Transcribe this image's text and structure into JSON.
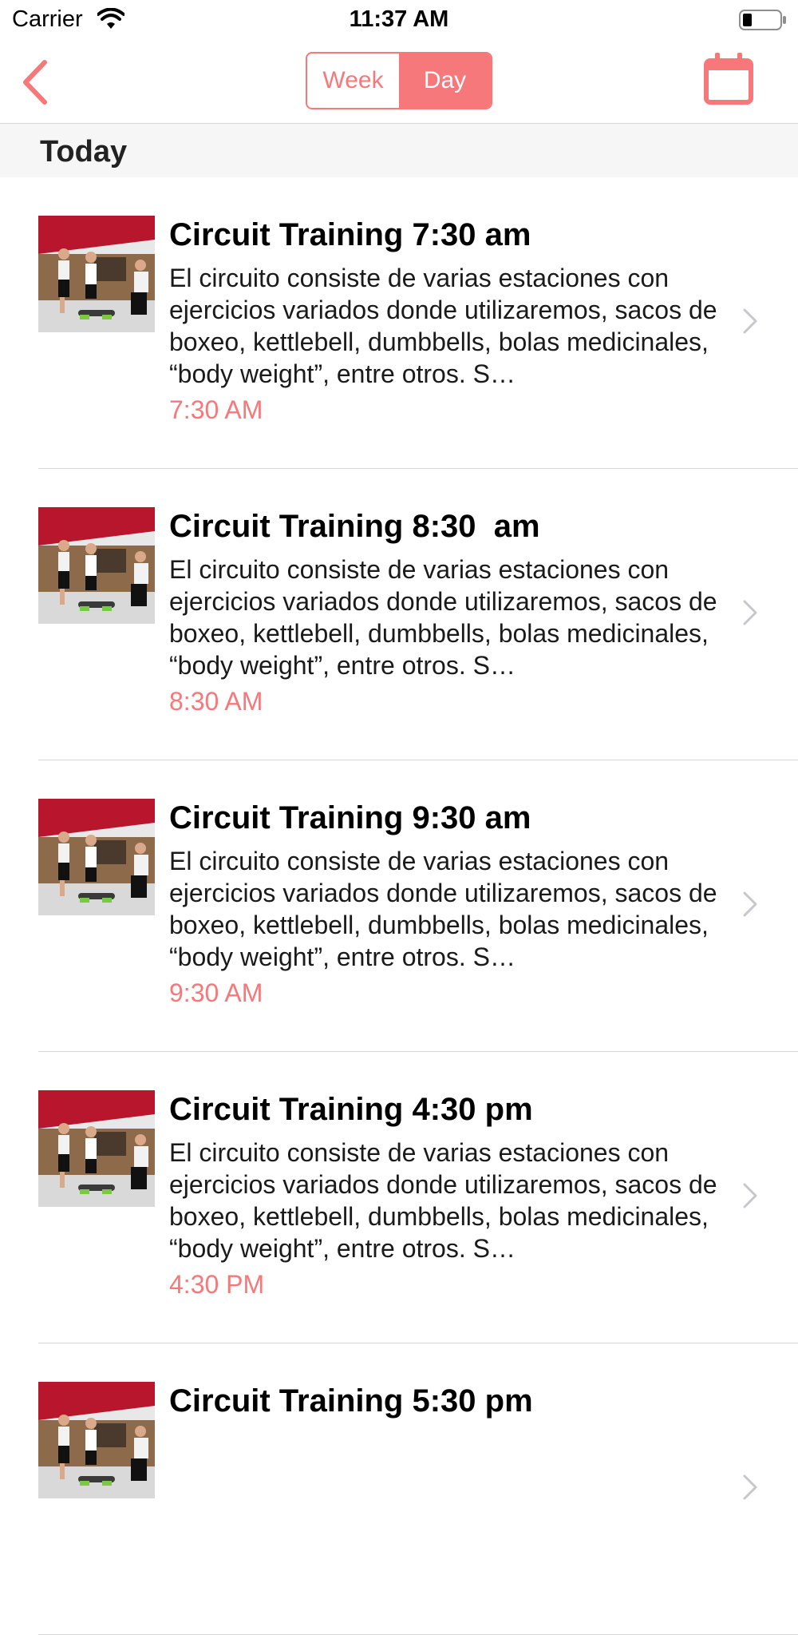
{
  "status_bar": {
    "carrier": "Carrier",
    "time": "11:37 AM",
    "wifi_icon": "wifi-icon",
    "battery_icon": "battery-icon",
    "battery_level": 0.25
  },
  "nav": {
    "back_icon": "chevron-left-icon",
    "segments": [
      "Week",
      "Day"
    ],
    "selected_segment": "Day",
    "calendar_icon": "calendar-icon",
    "accent_color": "#f6787a"
  },
  "section": {
    "title": "Today"
  },
  "classes": [
    {
      "title": "Circuit Training 7:30 am",
      "description": "El circuito consiste de varias estaciones con ejercicios variados donde utilizaremos, sacos de boxeo, kettlebell, dumbbells, bolas medicinales, “body weight”, entre otros. S…",
      "time": "7:30 AM"
    },
    {
      "title": "Circuit Training 8:30  am",
      "description": "El circuito consiste de varias estaciones con ejercicios variados donde utilizaremos, sacos de boxeo, kettlebell, dumbbells, bolas medicinales, “body weight”, entre otros. S…",
      "time": "8:30 AM"
    },
    {
      "title": "Circuit Training 9:30 am",
      "description": "El circuito consiste de varias estaciones con ejercicios variados donde utilizaremos, sacos de boxeo, kettlebell, dumbbells, bolas medicinales, “body weight”, entre otros. S…",
      "time": "9:30 AM"
    },
    {
      "title": "Circuit Training 4:30 pm",
      "description": "El circuito consiste de varias estaciones con ejercicios variados donde utilizaremos, sacos de boxeo, kettlebell, dumbbells, bolas medicinales, “body weight”, entre otros. S…",
      "time": "4:30 PM"
    },
    {
      "title": "Circuit Training 5:30 pm",
      "description": "",
      "time": ""
    }
  ]
}
